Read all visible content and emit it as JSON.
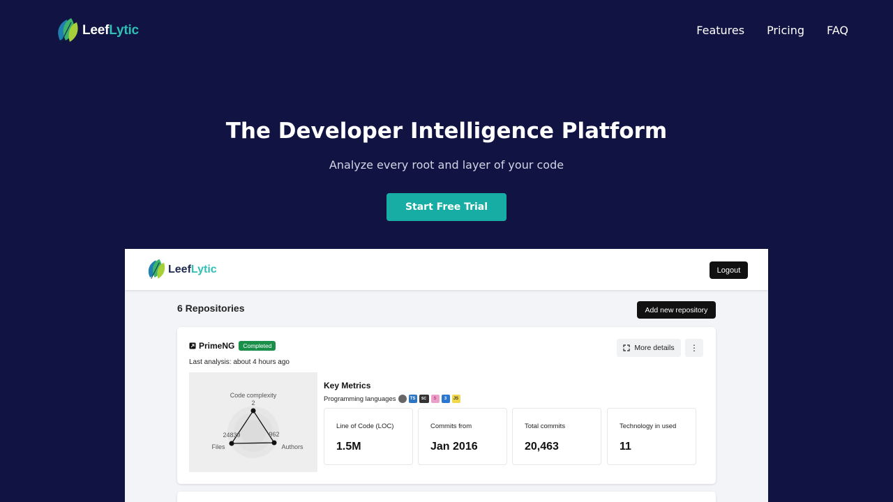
{
  "nav": {
    "logo": {
      "part1": "Leef",
      "part2": "Lytic"
    },
    "links": [
      "Features",
      "Pricing",
      "FAQ"
    ]
  },
  "hero": {
    "title": "The Developer Intelligence Platform",
    "subtitle": "Analyze every root and layer of your code",
    "cta_label": "Start Free Trial"
  },
  "colors": {
    "background": "#111442",
    "accent": "#18ada4",
    "badge_green": "#1a8f4a"
  },
  "preview": {
    "logo": {
      "part1": "Leef",
      "part2": "Lytic"
    },
    "logout_label": "Logout",
    "repositories_heading": "6 Repositories",
    "add_repository_label": "Add new repository",
    "repo": {
      "name": "PrimeNG",
      "status": "Completed",
      "last_analysis": "Last analysis: about 4 hours ago",
      "more_details_label": "More details",
      "radar": {
        "axes": [
          {
            "label": "Code complexity",
            "value": "2"
          },
          {
            "label": "Authors",
            "value": "962"
          },
          {
            "label": "Files",
            "value": "24839"
          }
        ]
      },
      "key_metrics_title": "Key Metrics",
      "programming_languages_label": "Programming languages",
      "languages": [
        {
          "icon": "generic-language-icon",
          "text": ""
        },
        {
          "icon": "typescript-icon",
          "text": "TS"
        },
        {
          "icon": "scss-icon",
          "text": "SC"
        },
        {
          "icon": "sass-icon",
          "text": "S"
        },
        {
          "icon": "css3-icon",
          "text": "3"
        },
        {
          "icon": "javascript-icon",
          "text": "JS"
        }
      ],
      "metrics": [
        {
          "label": "Line of Code (LOC)",
          "value": "1.5M"
        },
        {
          "label": "Commits from",
          "value": "Jan 2016"
        },
        {
          "label": "Total commits",
          "value": "20,463"
        },
        {
          "label": "Technology in used",
          "value": "11"
        }
      ]
    }
  }
}
